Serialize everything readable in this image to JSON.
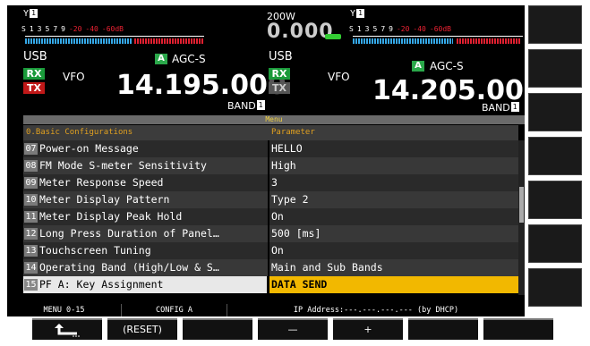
{
  "main_vfo": {
    "antenna_label": "Y",
    "antenna_number": "1",
    "s_scale": [
      "S",
      "1",
      "3",
      "5",
      "7",
      "9",
      "-20",
      "-40",
      "-60dB"
    ],
    "mode": "USB",
    "rx": "RX",
    "tx": "TX",
    "vfo": "VFO",
    "a_badge": "A",
    "agc": "AGC-S",
    "freq_main": "14.195.00",
    "freq_dim": "0",
    "band_label": "BAND",
    "band_number": "1"
  },
  "sub_vfo": {
    "antenna_label": "Y",
    "antenna_number": "1",
    "s_scale": [
      "S",
      "1",
      "3",
      "5",
      "7",
      "9",
      "-20",
      "-40",
      "-60dB"
    ],
    "mode": "USB",
    "rx": "RX",
    "tx": "TX",
    "vfo": "VFO",
    "a_badge": "A",
    "agc": "AGC-S",
    "freq_main": "14.205.00",
    "freq_dim": "0",
    "band_label": "BAND",
    "band_number": "1"
  },
  "power": {
    "label": "200W",
    "value": "0.000"
  },
  "menu": {
    "title": "Menu",
    "header": {
      "group": "0.Basic Configurations",
      "param": "Parameter"
    },
    "rows": [
      {
        "num": "07",
        "name": "Power-on Message",
        "param": "HELLO"
      },
      {
        "num": "08",
        "name": "FM Mode S-meter Sensitivity",
        "param": "High"
      },
      {
        "num": "09",
        "name": "Meter Response Speed",
        "param": "3"
      },
      {
        "num": "10",
        "name": "Meter Display Pattern",
        "param": "Type 2"
      },
      {
        "num": "11",
        "name": "Meter Display Peak Hold",
        "param": "On"
      },
      {
        "num": "12",
        "name": "Long Press Duration of Panel…",
        "param": "500 [ms]"
      },
      {
        "num": "13",
        "name": "Touchscreen Tuning",
        "param": "On"
      },
      {
        "num": "14",
        "name": "Operating Band (High/Low & S…",
        "param": "Main and Sub Bands"
      },
      {
        "num": "15",
        "name": "PF A: Key Assignment",
        "param": "DATA SEND"
      }
    ]
  },
  "status": {
    "menu_id": "MENU 0-15",
    "config": "CONFIG A",
    "ip": "IP Address:---.---.---.--- (by DHCP)"
  },
  "softkeys": {
    "reset": "(RESET)",
    "minus": "—",
    "plus": "+"
  },
  "colors": {
    "selected_param_bg": "#f2b800",
    "selected_name_bg": "#e8e8e8",
    "rx_green": "#1a9a3a",
    "tx_red": "#c01818",
    "meter_blue": "#35a8e8"
  }
}
